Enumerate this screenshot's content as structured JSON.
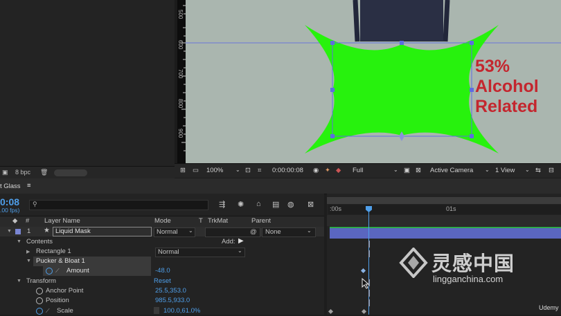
{
  "project_footer": {
    "bpc": "8 bpc"
  },
  "ruler": {
    "marks": [
      "500",
      "600",
      "700",
      "800",
      "900"
    ]
  },
  "canvas": {
    "text_lines": [
      "53%",
      "Alcohol",
      "Related"
    ],
    "shape_color": "#27f20d",
    "text_color": "#c4262e",
    "bg_color": "#aab6af"
  },
  "viewer_bar": {
    "zoom": "100%",
    "timecode": "0:00:00:08",
    "resolution": "Full",
    "camera": "Active Camera",
    "views": "1 View"
  },
  "timeline": {
    "comp_tab": "t Glass",
    "menu_icon": "≡",
    "current_time": "0:08",
    "fps": ".00 fps)",
    "search_placeholder": "",
    "headers": {
      "num": "#",
      "layer_name": "Layer Name",
      "mode": "Mode",
      "t": "T",
      "trkmat": "TrkMat",
      "parent": "Parent"
    },
    "ruler": {
      "start": ":00s",
      "one_sec": "01s"
    },
    "rows": {
      "layer": {
        "num": "1",
        "name": "Liquid Mask",
        "mode": "Normal",
        "parent": "None"
      },
      "contents": {
        "label": "Contents",
        "add": "Add:"
      },
      "rect": {
        "label": "Rectangle 1",
        "mode": "Normal"
      },
      "pucker": {
        "label": "Pucker & Bloat 1"
      },
      "amount": {
        "label": "Amount",
        "value": "-48.0"
      },
      "transform": {
        "label": "Transform",
        "reset": "Reset"
      },
      "anchor": {
        "label": "Anchor Point",
        "value": "25.5,353.0"
      },
      "position": {
        "label": "Position",
        "value": "985.5,933.0"
      },
      "scale": {
        "label": "Scale",
        "value": "100.0,61.0%"
      }
    }
  },
  "watermark": {
    "brand_cn": "灵感中国",
    "url": "lingganchina.com",
    "udemy": "Udemy"
  }
}
